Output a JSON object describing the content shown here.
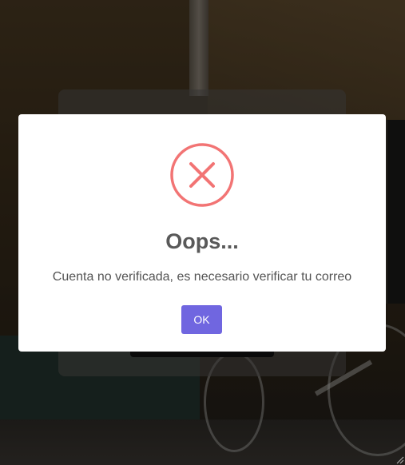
{
  "modal": {
    "title": "Oops...",
    "message": "Cuenta no verificada, es necesario verificar tu correo",
    "confirm_label": "OK",
    "icon": "error-x-icon",
    "icon_color": "#f27474",
    "confirm_color": "#7066e0"
  }
}
